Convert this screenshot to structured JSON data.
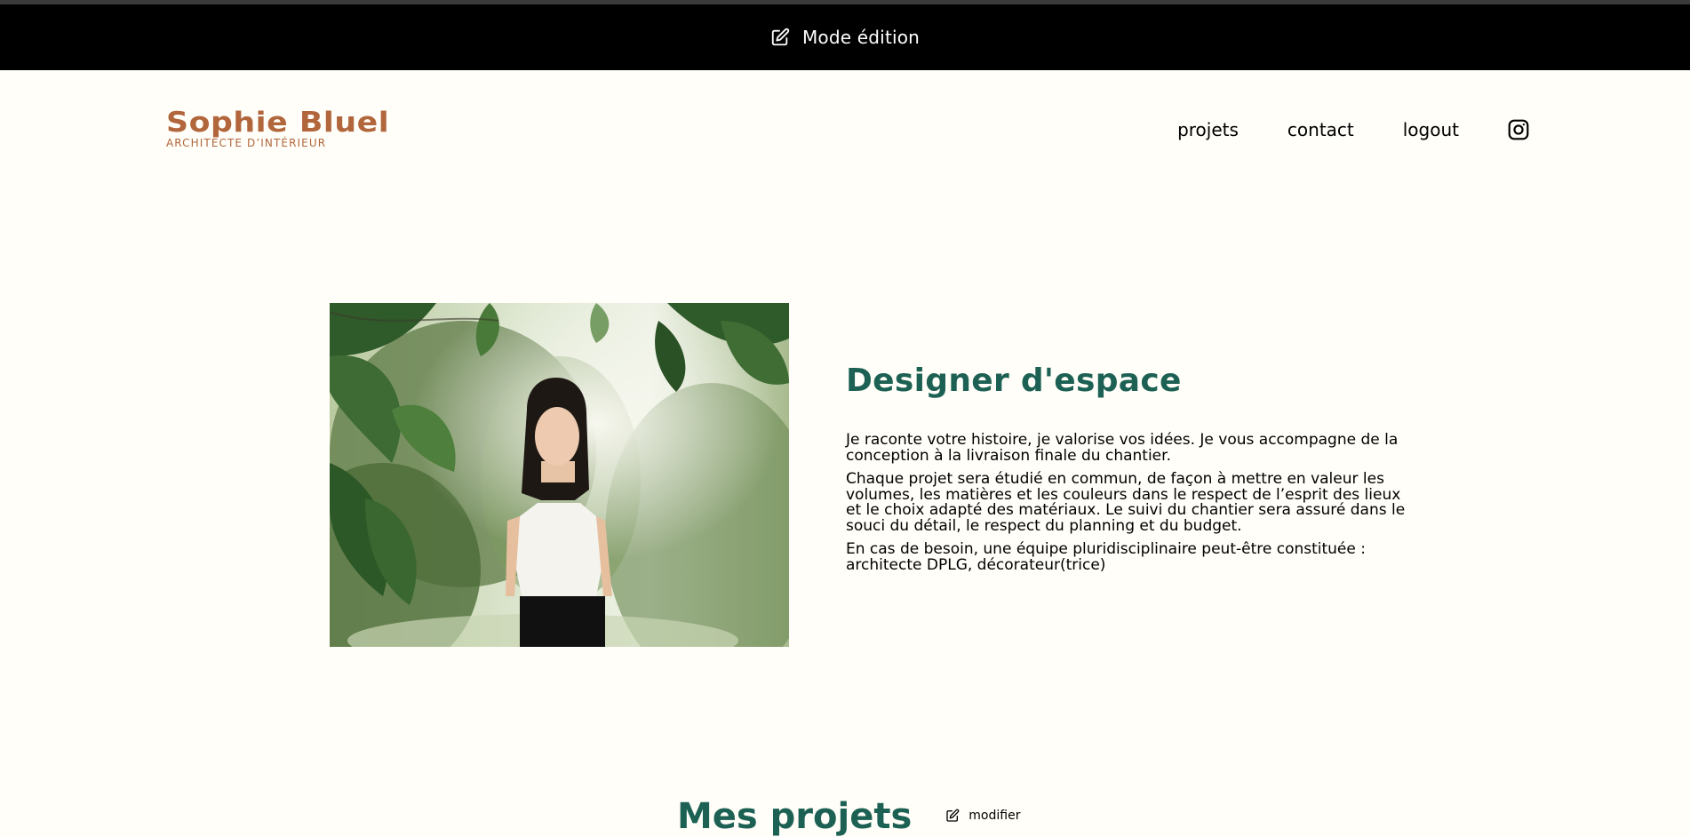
{
  "banner": {
    "label": "Mode édition"
  },
  "logo": {
    "name": "Sophie Bluel",
    "subtitle": "ARCHITECTE D’INTÉRIEUR"
  },
  "nav": {
    "items": [
      {
        "label": "projets"
      },
      {
        "label": "contact"
      },
      {
        "label": "logout"
      }
    ],
    "social_icon": "instagram-icon"
  },
  "intro": {
    "title": "Designer d'espace",
    "paragraphs": [
      "Je raconte votre histoire, je valorise vos idées. Je vous accompagne de la conception à la livraison finale du chantier.",
      "Chaque projet sera étudié en commun, de façon à mettre en valeur les volumes, les matières et les couleurs dans le respect de l’esprit des lieux et le choix adapté des matériaux. Le suivi du chantier sera assuré dans le souci du détail, le respect du planning et du budget.",
      "En cas de besoin, une équipe pluridisciplinaire peut-être constituée : architecte DPLG, décorateur(trice)"
    ]
  },
  "projects": {
    "title": "Mes projets",
    "modify_label": "modifier"
  },
  "colors": {
    "background": "#FFFEF8",
    "brand": "#B1663C",
    "accent": "#1D6154",
    "banner": "#000000"
  }
}
